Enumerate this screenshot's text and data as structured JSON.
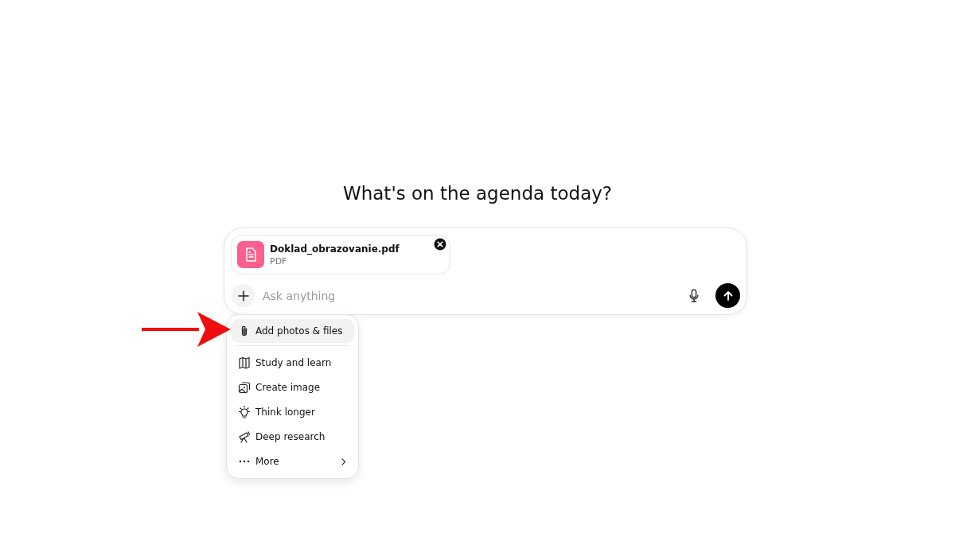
{
  "heading": "What's on the agenda today?",
  "composer": {
    "attachment": {
      "name": "Doklad_obrazovanie.pdf",
      "type": "PDF"
    },
    "placeholder": "Ask anything"
  },
  "menu": {
    "items": [
      {
        "label": "Add photos & files",
        "selected": true,
        "has_submenu": false
      },
      {
        "label": "Study and learn",
        "selected": false,
        "has_submenu": false
      },
      {
        "label": "Create image",
        "selected": false,
        "has_submenu": false
      },
      {
        "label": "Think longer",
        "selected": false,
        "has_submenu": false
      },
      {
        "label": "Deep research",
        "selected": false,
        "has_submenu": false
      },
      {
        "label": "More",
        "selected": false,
        "has_submenu": true
      }
    ]
  }
}
